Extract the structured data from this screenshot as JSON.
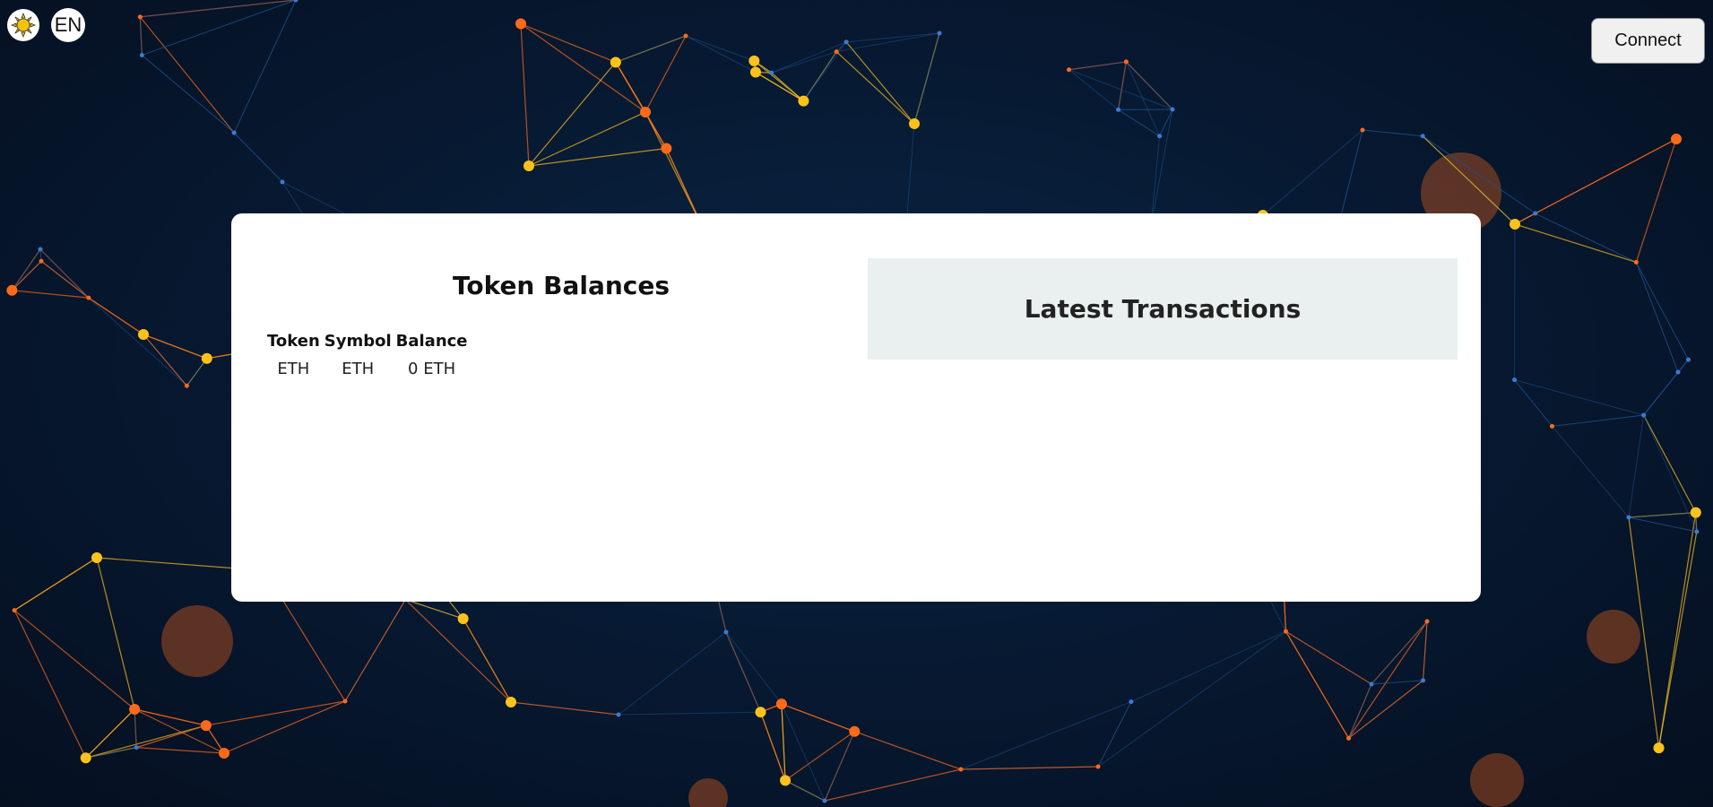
{
  "header": {
    "theme_icon": "sun-icon",
    "language_label": "EN",
    "connect_label": "Connect"
  },
  "balances": {
    "title": "Token Balances",
    "columns": [
      "Token",
      "Symbol",
      "Balance"
    ],
    "rows": [
      [
        "ETH",
        "ETH",
        "0 ETH"
      ]
    ]
  },
  "transactions": {
    "title": "Latest Transactions"
  },
  "colors": {
    "background": "#071a33",
    "node_orange": "#ff6a1a",
    "node_yellow": "#ffc21a",
    "line_blue": "#1d4f8a",
    "card": "#ffffff",
    "transactions_panel": "#eaf0f0"
  }
}
